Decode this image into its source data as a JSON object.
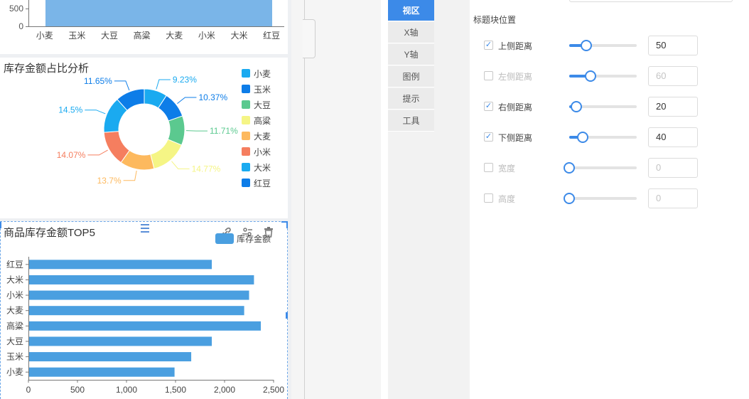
{
  "top_chart": {
    "ytick_labels": [
      "500",
      "0"
    ],
    "xtick_labels": [
      "小麦",
      "玉米",
      "大豆",
      "高粱",
      "大麦",
      "小米",
      "大米",
      "红豆"
    ],
    "bar_color": "#7ab5e8"
  },
  "chart_data": [
    {
      "type": "bar",
      "title": "",
      "categories": [
        "小麦",
        "玉米",
        "大豆",
        "高粱",
        "大麦",
        "小米",
        "大米",
        "红豆"
      ],
      "yticks": [
        0,
        500
      ],
      "ylim_visible": [
        0,
        700
      ],
      "note": "cropped panel; bars extend above visible area"
    },
    {
      "type": "pie",
      "title": "库存金额占比分析",
      "categories": [
        "小麦",
        "玉米",
        "大豆",
        "高粱",
        "大麦",
        "小米",
        "大米",
        "红豆"
      ],
      "values": [
        9.23,
        10.37,
        11.71,
        14.77,
        13.7,
        14.07,
        14.5,
        11.65
      ],
      "value_labels": [
        "9.23%",
        "10.37%",
        "11.71%",
        "14.77%",
        "13.7%",
        "14.07%",
        "14.5%",
        "11.65%"
      ],
      "colors": [
        "#1aaaf0",
        "#0d7de8",
        "#5bc98f",
        "#f5f585",
        "#fdb95e",
        "#f57e5f",
        "#1aaaf0",
        "#0d7de8"
      ],
      "legend_position": "right"
    },
    {
      "type": "bar",
      "orientation": "horizontal",
      "title": "商品库存金额TOP5",
      "legend": [
        "库存金额"
      ],
      "categories": [
        "小麦",
        "玉米",
        "大豆",
        "高粱",
        "大麦",
        "小米",
        "大米",
        "红豆"
      ],
      "values": [
        1490,
        1660,
        1870,
        2370,
        2200,
        2250,
        2300,
        1870
      ],
      "xlim": [
        0,
        2500
      ],
      "xticks": [
        "0",
        "500",
        "1,000",
        "1,500",
        "2,000",
        "2,500"
      ],
      "color": "#4a9fe0"
    }
  ],
  "toolbar_icons": [
    "link-icon",
    "filter-icon",
    "trash-icon"
  ],
  "tabs": [
    {
      "label": "视区",
      "active": true
    },
    {
      "label": "X轴",
      "active": false
    },
    {
      "label": "Y轴",
      "active": false
    },
    {
      "label": "图例",
      "active": false
    },
    {
      "label": "提示",
      "active": false
    },
    {
      "label": "工具",
      "active": false
    }
  ],
  "section_title": "标题块位置",
  "rows": [
    {
      "label": "上侧距离",
      "checked": true,
      "value": "50",
      "level": 0.25
    },
    {
      "label": "左侧距离",
      "checked": false,
      "value": "60",
      "level": 0.32
    },
    {
      "label": "右侧距离",
      "checked": true,
      "value": "20",
      "level": 0.1
    },
    {
      "label": "下侧距离",
      "checked": true,
      "value": "40",
      "level": 0.2
    },
    {
      "label": "宽度",
      "checked": false,
      "value": "0",
      "level": 0
    },
    {
      "label": "高度",
      "checked": false,
      "value": "0",
      "level": 0
    }
  ],
  "colors": {
    "accent": "#3c8ae8"
  }
}
